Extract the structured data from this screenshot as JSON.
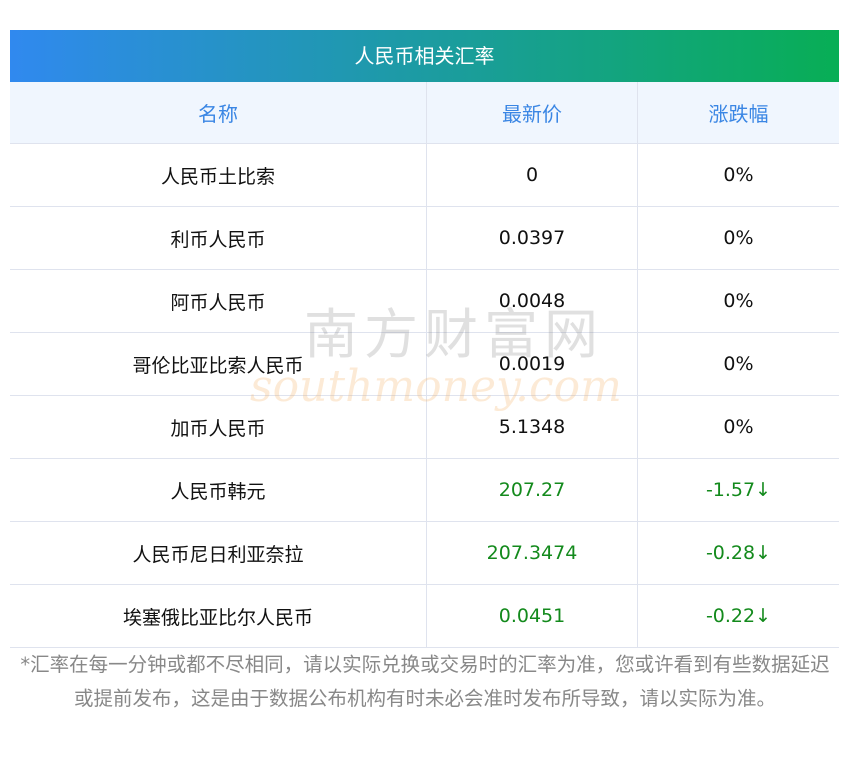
{
  "title": "人民币相关汇率",
  "columns": [
    "名称",
    "最新价",
    "涨跌幅"
  ],
  "rows": [
    {
      "name": "人民币土比索",
      "price": "0",
      "change": "0%",
      "trend": "flat"
    },
    {
      "name": "利币人民币",
      "price": "0.0397",
      "change": "0%",
      "trend": "flat"
    },
    {
      "name": "阿币人民币",
      "price": "0.0048",
      "change": "0%",
      "trend": "flat"
    },
    {
      "name": "哥伦比亚比索人民币",
      "price": "0.0019",
      "change": "0%",
      "trend": "flat"
    },
    {
      "name": "加币人民币",
      "price": "5.1348",
      "change": "0%",
      "trend": "flat"
    },
    {
      "name": "人民币韩元",
      "price": "207.27",
      "change": "-1.57↓",
      "trend": "down"
    },
    {
      "name": "人民币尼日利亚奈拉",
      "price": "207.3474",
      "change": "-0.28↓",
      "trend": "down"
    },
    {
      "name": "埃塞俄比亚比尔人民币",
      "price": "0.0451",
      "change": "-0.22↓",
      "trend": "down"
    }
  ],
  "note": "*汇率在每一分钟或都不尽相同，请以实际兑换或交易时的汇率为准，您或许看到有些数据延迟或提前发布，这是由于数据公布机构有时未必会准时发布所导致，请以实际为准。",
  "watermark": {
    "cn": "南方财富网",
    "en": "southmoney.com"
  },
  "colors": {
    "down": "#138a1c",
    "header_text": "#3a86e4",
    "gradient_start": "#3089ef",
    "gradient_end": "#08ae55"
  }
}
